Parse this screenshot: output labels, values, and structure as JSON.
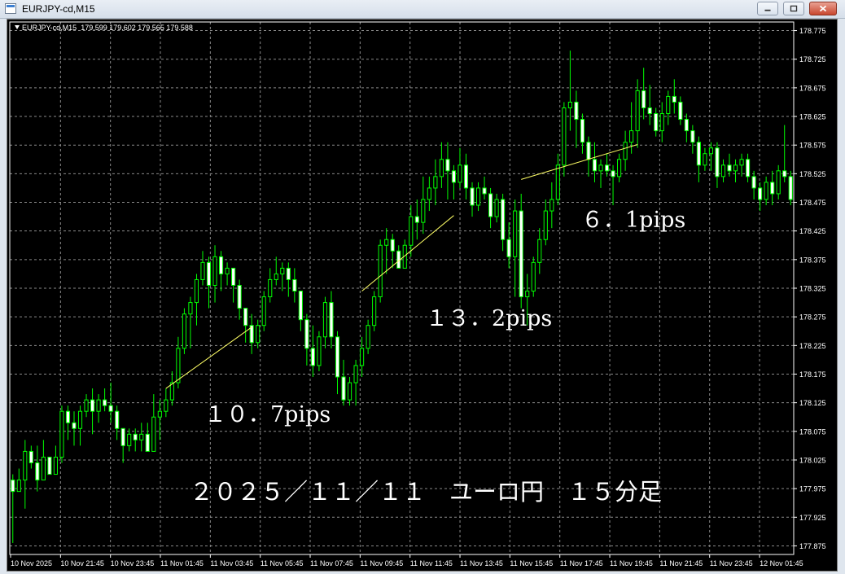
{
  "window": {
    "title": "EURJPY-cd,M15",
    "icon": "chart-window-icon",
    "buttons": [
      "minimize-icon",
      "maximize-icon",
      "close-icon"
    ]
  },
  "chart_info": {
    "symbol_line": "EURJPY-cd,M15",
    "ohlc": "179.599 179.602 179.565 179.588"
  },
  "annotations": {
    "move1": "１０．7pips",
    "move2": "１３．2pips",
    "move3": "６．1pips",
    "caption": "２０２５／１１／１１　ユーロ円　１５分足"
  },
  "colors": {
    "background": "#000000",
    "grid": "#8a8a8a",
    "candle": "#00ff00",
    "bull_body": "#000000",
    "bear_body": "#ffffff",
    "trend_line": "#ffff66",
    "axis_text": "#ffffff"
  },
  "chart_data": {
    "type": "candlestick",
    "symbol": "EURJPY-cd",
    "timeframe": "M15",
    "y_ticks": [
      177.875,
      177.925,
      177.975,
      178.025,
      178.075,
      178.125,
      178.175,
      178.225,
      178.275,
      178.325,
      178.375,
      178.425,
      178.475,
      178.525,
      178.575,
      178.625,
      178.675,
      178.725,
      178.775
    ],
    "y_tick_labels": [
      "177.875",
      "177.925",
      "177.975",
      "178.025",
      "178.075",
      "178.125",
      "178.175",
      "178.225",
      "178.275",
      "178.325",
      "178.375",
      "178.425",
      "178.475",
      "178.525",
      "178.575",
      "178.625",
      "178.675",
      "178.725",
      "178.775"
    ],
    "ylim": [
      177.86,
      178.79
    ],
    "x_tick_labels": [
      "10 Nov 2025",
      "10 Nov 21:45",
      "10 Nov 23:45",
      "11 Nov 01:45",
      "11 Nov 03:45",
      "11 Nov 05:45",
      "11 Nov 07:45",
      "11 Nov 09:45",
      "11 Nov 11:45",
      "11 Nov 13:45",
      "11 Nov 15:45",
      "11 Nov 17:45",
      "11 Nov 19:45",
      "11 Nov 21:45",
      "11 Nov 23:45",
      "12 Nov 01:45"
    ],
    "bars_total": 128,
    "ohlc": [
      [
        177.99,
        178.0,
        177.88,
        177.97
      ],
      [
        177.97,
        178.01,
        177.97,
        177.99
      ],
      [
        177.99,
        178.06,
        177.94,
        178.04
      ],
      [
        178.04,
        178.05,
        178.01,
        178.02
      ],
      [
        178.02,
        178.05,
        177.97,
        177.99
      ],
      [
        177.99,
        178.06,
        177.99,
        178.03
      ],
      [
        178.03,
        178.03,
        178.0,
        178.0
      ],
      [
        178.0,
        178.05,
        178.0,
        178.03
      ],
      [
        178.03,
        178.12,
        178.02,
        178.11
      ],
      [
        178.11,
        178.12,
        178.06,
        178.09
      ],
      [
        178.09,
        178.11,
        178.05,
        178.08
      ],
      [
        178.08,
        178.12,
        178.05,
        178.11
      ],
      [
        178.11,
        178.14,
        178.1,
        178.13
      ],
      [
        178.13,
        178.15,
        178.07,
        178.11
      ],
      [
        178.11,
        178.14,
        178.09,
        178.13
      ],
      [
        178.13,
        178.15,
        178.11,
        178.12
      ],
      [
        178.12,
        178.16,
        178.09,
        178.11
      ],
      [
        178.11,
        178.12,
        178.06,
        178.08
      ],
      [
        178.08,
        178.08,
        178.02,
        178.05
      ],
      [
        178.05,
        178.08,
        178.04,
        178.07
      ],
      [
        178.07,
        178.08,
        178.04,
        178.06
      ],
      [
        178.06,
        178.09,
        178.04,
        178.07
      ],
      [
        178.07,
        178.09,
        178.05,
        178.04
      ],
      [
        178.04,
        178.14,
        178.04,
        178.1
      ],
      [
        178.1,
        178.13,
        178.06,
        178.11
      ],
      [
        178.11,
        178.15,
        178.1,
        178.13
      ],
      [
        178.13,
        178.18,
        178.12,
        178.16
      ],
      [
        178.16,
        178.24,
        178.15,
        178.22
      ],
      [
        178.22,
        178.29,
        178.21,
        178.28
      ],
      [
        178.28,
        178.31,
        178.22,
        178.3
      ],
      [
        178.3,
        178.35,
        178.26,
        178.34
      ],
      [
        178.34,
        178.39,
        178.33,
        178.37
      ],
      [
        178.37,
        178.38,
        178.29,
        178.33
      ],
      [
        178.33,
        178.4,
        178.3,
        178.38
      ],
      [
        178.38,
        178.39,
        178.32,
        178.35
      ],
      [
        178.35,
        178.37,
        178.33,
        178.36
      ],
      [
        178.36,
        178.36,
        178.3,
        178.33
      ],
      [
        178.33,
        178.34,
        178.27,
        178.29
      ],
      [
        178.29,
        178.29,
        178.23,
        178.26
      ],
      [
        178.26,
        178.28,
        178.21,
        178.23
      ],
      [
        178.23,
        178.27,
        178.22,
        178.26
      ],
      [
        178.26,
        178.32,
        178.25,
        178.31
      ],
      [
        178.31,
        178.36,
        178.3,
        178.34
      ],
      [
        178.34,
        178.38,
        178.33,
        178.35
      ],
      [
        178.35,
        178.37,
        178.32,
        178.36
      ],
      [
        178.36,
        178.37,
        178.31,
        178.34
      ],
      [
        178.34,
        178.36,
        178.3,
        178.32
      ],
      [
        178.32,
        178.32,
        178.25,
        178.27
      ],
      [
        178.27,
        178.28,
        178.19,
        178.22
      ],
      [
        178.22,
        178.26,
        178.17,
        178.19
      ],
      [
        178.19,
        178.25,
        178.18,
        178.24
      ],
      [
        178.24,
        178.31,
        178.22,
        178.3
      ],
      [
        178.3,
        178.32,
        178.22,
        178.24
      ],
      [
        178.24,
        178.25,
        178.14,
        178.17
      ],
      [
        178.17,
        178.2,
        178.12,
        178.13
      ],
      [
        178.13,
        178.17,
        178.12,
        178.16
      ],
      [
        178.16,
        178.2,
        178.12,
        178.19
      ],
      [
        178.19,
        178.24,
        178.17,
        178.22
      ],
      [
        178.22,
        178.27,
        178.21,
        178.26
      ],
      [
        178.26,
        178.32,
        178.25,
        178.31
      ],
      [
        178.31,
        178.41,
        178.3,
        178.4
      ],
      [
        178.4,
        178.43,
        178.35,
        178.41
      ],
      [
        178.41,
        178.42,
        178.36,
        178.39
      ],
      [
        178.39,
        178.4,
        178.36,
        178.36
      ],
      [
        178.36,
        178.41,
        178.36,
        178.4
      ],
      [
        178.4,
        178.47,
        178.38,
        178.45
      ],
      [
        178.45,
        178.48,
        178.41,
        178.44
      ],
      [
        178.44,
        178.52,
        178.42,
        178.48
      ],
      [
        178.48,
        178.52,
        178.46,
        178.5
      ],
      [
        178.5,
        178.55,
        178.47,
        178.52
      ],
      [
        178.52,
        178.58,
        178.5,
        178.55
      ],
      [
        178.55,
        178.58,
        178.48,
        178.53
      ],
      [
        178.53,
        178.54,
        178.48,
        178.51
      ],
      [
        178.51,
        178.57,
        178.5,
        178.54
      ],
      [
        178.54,
        178.56,
        178.48,
        178.5
      ],
      [
        178.5,
        178.51,
        178.45,
        178.47
      ],
      [
        178.47,
        178.51,
        178.46,
        178.5
      ],
      [
        178.5,
        178.52,
        178.48,
        178.49
      ],
      [
        178.49,
        178.5,
        178.43,
        178.45
      ],
      [
        178.45,
        178.49,
        178.44,
        178.48
      ],
      [
        178.48,
        178.49,
        178.39,
        178.41
      ],
      [
        178.41,
        178.44,
        178.36,
        178.38
      ],
      [
        178.38,
        178.48,
        178.31,
        178.46
      ],
      [
        178.46,
        178.49,
        178.29,
        178.31
      ],
      [
        178.31,
        178.35,
        178.26,
        178.32
      ],
      [
        178.32,
        178.38,
        178.31,
        178.37
      ],
      [
        178.37,
        178.43,
        178.35,
        178.41
      ],
      [
        178.41,
        178.48,
        178.4,
        178.46
      ],
      [
        178.46,
        178.51,
        178.43,
        178.48
      ],
      [
        178.48,
        178.56,
        178.47,
        178.54
      ],
      [
        178.54,
        178.65,
        178.52,
        178.64
      ],
      [
        178.64,
        178.74,
        178.6,
        178.65
      ],
      [
        178.65,
        178.67,
        178.57,
        178.62
      ],
      [
        178.62,
        178.63,
        178.56,
        178.58
      ],
      [
        178.58,
        178.59,
        178.52,
        178.55
      ],
      [
        178.55,
        178.58,
        178.51,
        178.53
      ],
      [
        178.53,
        178.55,
        178.5,
        178.54
      ],
      [
        178.54,
        178.56,
        178.52,
        178.53
      ],
      [
        178.53,
        178.54,
        178.47,
        178.52
      ],
      [
        178.52,
        178.56,
        178.51,
        178.55
      ],
      [
        178.55,
        178.6,
        178.53,
        178.58
      ],
      [
        178.58,
        178.65,
        178.56,
        178.6
      ],
      [
        178.6,
        178.69,
        178.57,
        178.67
      ],
      [
        178.67,
        178.71,
        178.62,
        178.64
      ],
      [
        178.64,
        178.68,
        178.61,
        178.63
      ],
      [
        178.63,
        178.64,
        178.59,
        178.6
      ],
      [
        178.6,
        178.65,
        178.58,
        178.63
      ],
      [
        178.63,
        178.67,
        178.61,
        178.66
      ],
      [
        178.66,
        178.69,
        178.63,
        178.65
      ],
      [
        178.65,
        178.66,
        178.61,
        178.62
      ],
      [
        178.62,
        178.63,
        178.58,
        178.6
      ],
      [
        178.6,
        178.61,
        178.56,
        178.58
      ],
      [
        178.58,
        178.59,
        178.51,
        178.54
      ],
      [
        178.54,
        178.57,
        178.53,
        178.56
      ],
      [
        178.56,
        178.58,
        178.53,
        178.57
      ],
      [
        178.57,
        178.58,
        178.5,
        178.52
      ],
      [
        178.52,
        178.55,
        178.51,
        178.54
      ],
      [
        178.54,
        178.56,
        178.52,
        178.53
      ],
      [
        178.53,
        178.55,
        178.51,
        178.54
      ],
      [
        178.54,
        178.56,
        178.52,
        178.55
      ],
      [
        178.55,
        178.56,
        178.51,
        178.52
      ],
      [
        178.52,
        178.53,
        178.48,
        178.5
      ],
      [
        178.5,
        178.51,
        178.46,
        178.48
      ],
      [
        178.48,
        178.52,
        178.47,
        178.51
      ],
      [
        178.51,
        178.53,
        178.47,
        178.49
      ],
      [
        178.49,
        178.54,
        178.48,
        178.53
      ],
      [
        178.53,
        178.61,
        178.51,
        178.52
      ],
      [
        178.52,
        178.53,
        178.47,
        178.48
      ]
    ],
    "trend_lines": [
      {
        "name": "move-10.7pips",
        "from": [
          25,
          178.15
        ],
        "to": [
          39,
          178.257
        ]
      },
      {
        "name": "move-13.2pips",
        "from": [
          57,
          178.32
        ],
        "to": [
          72,
          178.452
        ]
      },
      {
        "name": "move-6.1pips",
        "from": [
          83,
          178.515
        ],
        "to": [
          102,
          178.576
        ]
      }
    ],
    "grid": true
  }
}
